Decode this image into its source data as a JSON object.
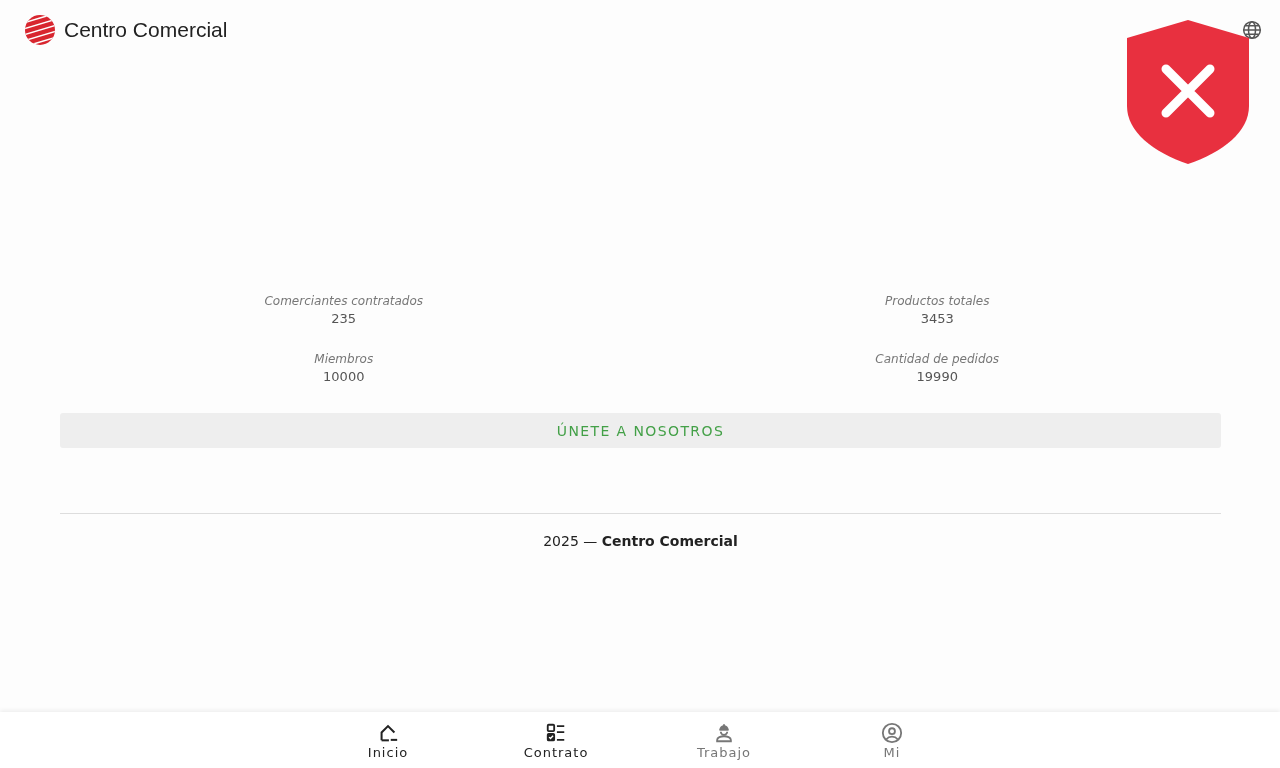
{
  "header": {
    "title": "Centro Comercial"
  },
  "stats": [
    {
      "label": "Comerciantes contratados",
      "value": "235"
    },
    {
      "label": "Productos totales",
      "value": "3453"
    },
    {
      "label": "Miembros",
      "value": "10000"
    },
    {
      "label": "Cantidad de pedidos",
      "value": "19990"
    }
  ],
  "join_button": {
    "label": "ÚNETE A NOSOTROS"
  },
  "footer": {
    "text": "2025 — **Centro Comercial**"
  },
  "bottom_nav": [
    {
      "label": "Inicio",
      "muted": false
    },
    {
      "label": "Contrato",
      "muted": false
    },
    {
      "label": "Trabajo",
      "muted": true
    },
    {
      "label": "Mi",
      "muted": true
    }
  ]
}
